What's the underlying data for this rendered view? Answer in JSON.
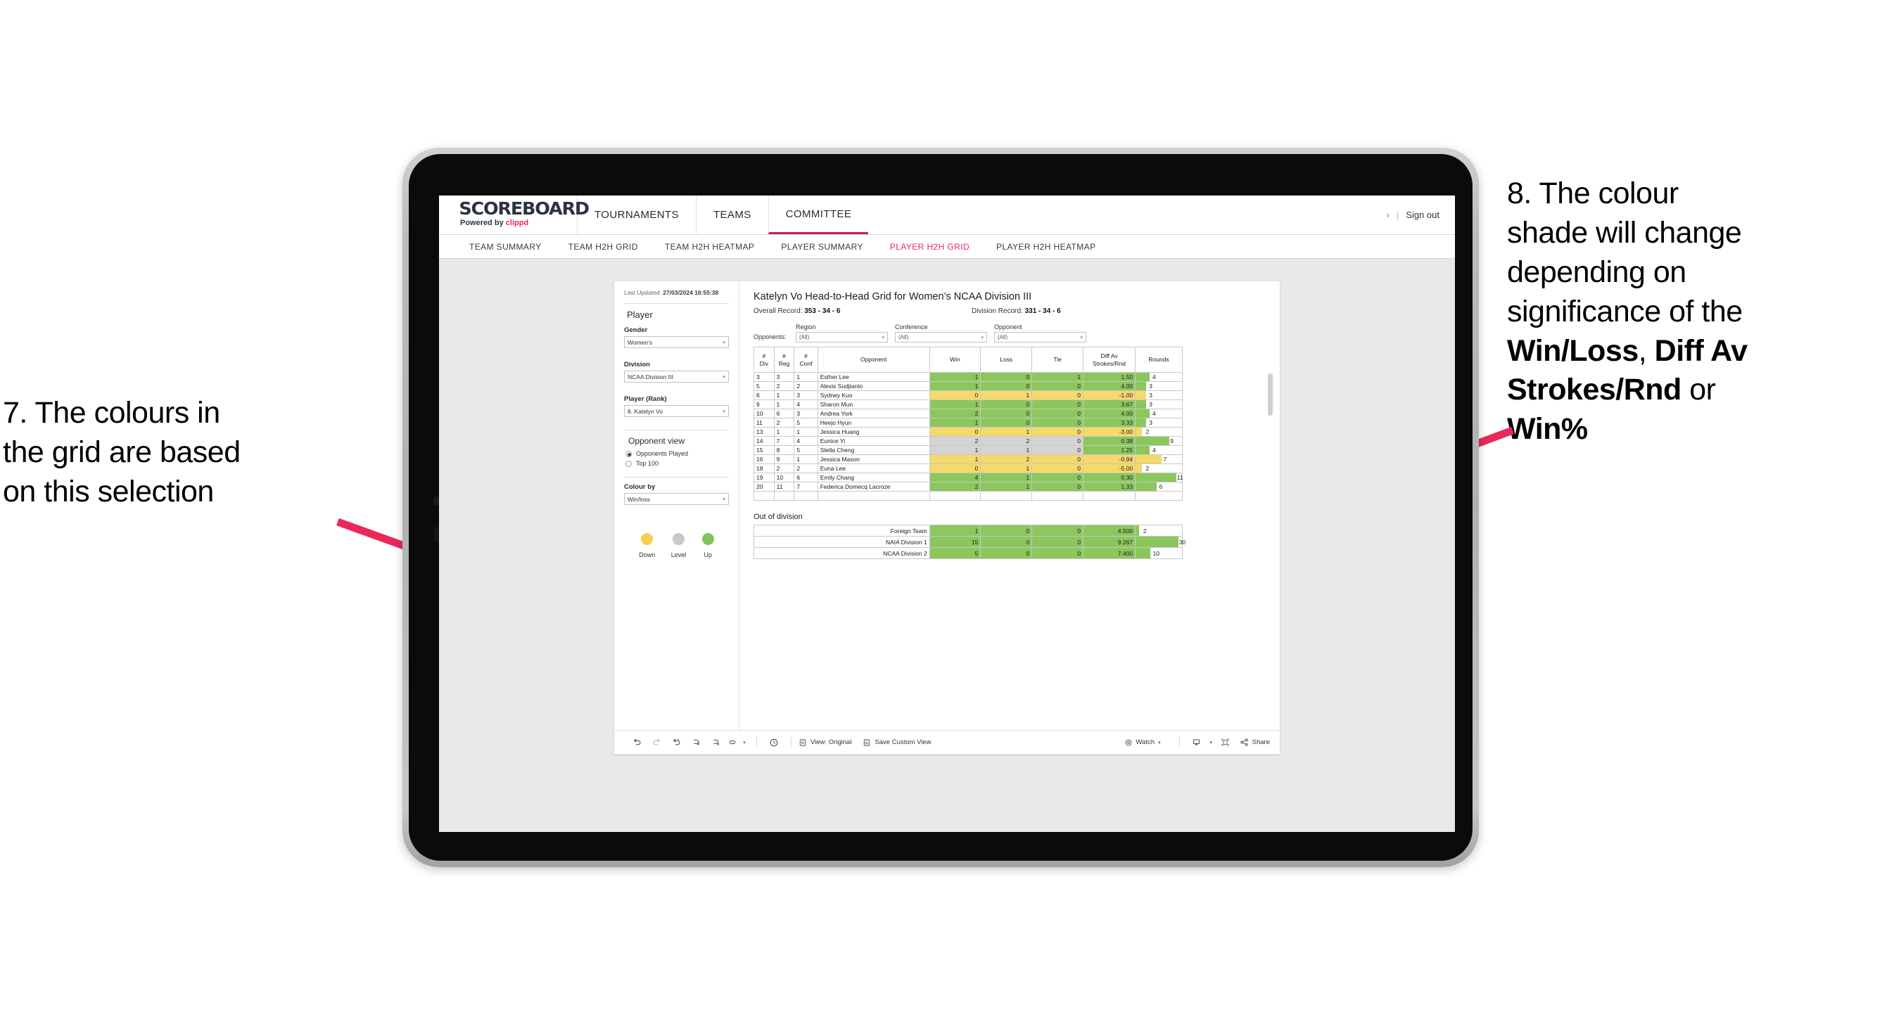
{
  "annotations": {
    "left": {
      "line1": "7. The colours in",
      "line2": "the grid are based",
      "line3": "on this selection"
    },
    "right": {
      "l1": "8. The colour",
      "l2": "shade will change",
      "l3": "depending on",
      "l4": "significance of the",
      "b1": "Win/Loss",
      "sep1": ", ",
      "b2": "Diff Av",
      "b3": "Strokes/Rnd",
      "mid": " or",
      "b4": "Win%"
    },
    "arrow_color": "#e8295a"
  },
  "header": {
    "logo_main": "SCOREBOARD",
    "logo_sub_prefix": "Powered by ",
    "logo_sub_brand": "clippd",
    "nav": [
      {
        "label": "TOURNAMENTS",
        "active": false
      },
      {
        "label": "TEAMS",
        "active": false
      },
      {
        "label": "COMMITTEE",
        "active": true
      }
    ],
    "chevron": "›",
    "divider": "|",
    "signout": "Sign out"
  },
  "subnav": [
    {
      "label": "TEAM SUMMARY",
      "active": false
    },
    {
      "label": "TEAM H2H GRID",
      "active": false
    },
    {
      "label": "TEAM H2H HEATMAP",
      "active": false
    },
    {
      "label": "PLAYER SUMMARY",
      "active": false
    },
    {
      "label": "PLAYER H2H GRID",
      "active": true
    },
    {
      "label": "PLAYER H2H HEATMAP",
      "active": false
    }
  ],
  "sidebar": {
    "last_updated_label": "Last Updated: ",
    "last_updated_value": "27/03/2024 16:55:38",
    "player_heading": "Player",
    "gender_label": "Gender",
    "gender_value": "Women’s",
    "division_label": "Division",
    "division_value": "NCAA Division III",
    "player_rank_label": "Player (Rank)",
    "player_rank_value": "8. Katelyn Vo",
    "opponent_view_heading": "Opponent view",
    "opponent_view_options": [
      {
        "label": "Opponents Played",
        "selected": true
      },
      {
        "label": "Top 100",
        "selected": false
      }
    ],
    "colour_by_label": "Colour by",
    "colour_by_value": "Win/loss",
    "legend": [
      {
        "label": "Down",
        "color": "#f3d14e"
      },
      {
        "label": "Level",
        "color": "#c6c8ca"
      },
      {
        "label": "Up",
        "color": "#82c35c"
      }
    ],
    "caret": "▾"
  },
  "main": {
    "title": "Katelyn Vo Head-to-Head Grid for Women’s NCAA Division III",
    "overall_record_label": "Overall Record: ",
    "overall_record_value": "353 -  34 - 6",
    "division_record_label": "Division Record: ",
    "division_record_value": "331 -  34 - 6",
    "opponents_label": "Opponents:",
    "filters": [
      {
        "label": "Region",
        "value": "(All)"
      },
      {
        "label": "Conference",
        "value": "(All)"
      },
      {
        "label": "Opponent",
        "value": "(All)"
      }
    ],
    "caret": "▾",
    "columns": [
      {
        "l1": "#",
        "l2": "Div"
      },
      {
        "l1": "#",
        "l2": "Reg"
      },
      {
        "l1": "#",
        "l2": "Conf"
      },
      {
        "l1": "Opponent",
        "l2": ""
      },
      {
        "l1": "Win",
        "l2": ""
      },
      {
        "l1": "Loss",
        "l2": ""
      },
      {
        "l1": "Tie",
        "l2": ""
      },
      {
        "l1": "Diff Av",
        "l2": "Strokes/Rnd"
      },
      {
        "l1": "Rounds",
        "l2": ""
      }
    ],
    "rows": [
      {
        "div": "3",
        "reg": "3",
        "conf": "1",
        "opponent": "Esther Lee",
        "win": "1",
        "loss": "0",
        "tie": "1",
        "diff": "1.50",
        "rounds": "4",
        "shade": "up",
        "bar_pct": 30
      },
      {
        "div": "5",
        "reg": "2",
        "conf": "2",
        "opponent": "Alexis Sudjianto",
        "win": "1",
        "loss": "0",
        "tie": "0",
        "diff": "4.00",
        "rounds": "3",
        "shade": "up",
        "bar_pct": 22
      },
      {
        "div": "6",
        "reg": "1",
        "conf": "3",
        "opponent": "Sydney Kuo",
        "win": "0",
        "loss": "1",
        "tie": "0",
        "diff": "-1.00",
        "rounds": "3",
        "shade": "down",
        "bar_pct": 22
      },
      {
        "div": "9",
        "reg": "1",
        "conf": "4",
        "opponent": "Sharon Mun",
        "win": "1",
        "loss": "0",
        "tie": "0",
        "diff": "3.67",
        "rounds": "3",
        "shade": "up",
        "bar_pct": 22
      },
      {
        "div": "10",
        "reg": "6",
        "conf": "3",
        "opponent": "Andrea York",
        "win": "2",
        "loss": "0",
        "tie": "0",
        "diff": "4.00",
        "rounds": "4",
        "shade": "up",
        "bar_pct": 30
      },
      {
        "div": "11",
        "reg": "2",
        "conf": "5",
        "opponent": "Heejo Hyun",
        "win": "1",
        "loss": "0",
        "tie": "0",
        "diff": "3.33",
        "rounds": "3",
        "shade": "up",
        "bar_pct": 22
      },
      {
        "div": "13",
        "reg": "1",
        "conf": "1",
        "opponent": "Jessica Huang",
        "win": "0",
        "loss": "1",
        "tie": "0",
        "diff": "-3.00",
        "rounds": "2",
        "shade": "down",
        "bar_pct": 14
      },
      {
        "div": "14",
        "reg": "7",
        "conf": "4",
        "opponent": "Eunice Yi",
        "win": "2",
        "loss": "2",
        "tie": "0",
        "diff": "0.38",
        "rounds": "9",
        "shade": "level",
        "bar_pct": 72,
        "diff_shade": "up"
      },
      {
        "div": "15",
        "reg": "8",
        "conf": "5",
        "opponent": "Stella Cheng",
        "win": "1",
        "loss": "1",
        "tie": "0",
        "diff": "1.25",
        "rounds": "4",
        "shade": "level",
        "bar_pct": 30,
        "diff_shade": "up"
      },
      {
        "div": "16",
        "reg": "9",
        "conf": "1",
        "opponent": "Jessica Mason",
        "win": "1",
        "loss": "2",
        "tie": "0",
        "diff": "-0.94",
        "rounds": "7",
        "shade": "down",
        "bar_pct": 56
      },
      {
        "div": "18",
        "reg": "2",
        "conf": "2",
        "opponent": "Euna Lee",
        "win": "0",
        "loss": "1",
        "tie": "0",
        "diff": "-5.00",
        "rounds": "2",
        "shade": "down",
        "bar_pct": 14
      },
      {
        "div": "19",
        "reg": "10",
        "conf": "6",
        "opponent": "Emily Chang",
        "win": "4",
        "loss": "1",
        "tie": "0",
        "diff": "0.30",
        "rounds": "11",
        "shade": "up",
        "bar_pct": 88
      },
      {
        "div": "20",
        "reg": "11",
        "conf": "7",
        "opponent": "Federica Domecq Lacroze",
        "win": "2",
        "loss": "1",
        "tie": "0",
        "diff": "1.33",
        "rounds": "6",
        "shade": "up",
        "bar_pct": 46
      }
    ],
    "out_of_division_title": "Out of division",
    "out_of_division_rows": [
      {
        "name": "Foreign Team",
        "win": "1",
        "loss": "0",
        "tie": "0",
        "diff": "4.500",
        "rounds": "2",
        "shade": "up",
        "bar_pct": 8
      },
      {
        "name": "NAIA Division 1",
        "win": "15",
        "loss": "0",
        "tie": "0",
        "diff": "9.267",
        "rounds": "30",
        "shade": "up",
        "bar_pct": 93
      },
      {
        "name": "NCAA Division 2",
        "win": "5",
        "loss": "0",
        "tie": "0",
        "diff": "7.400",
        "rounds": "10",
        "shade": "up",
        "bar_pct": 31
      }
    ]
  },
  "toolbar": {
    "icons": [
      "undo-icon",
      "redo-icon",
      "revert-icon",
      "refresh-icon",
      "pause-icon",
      "highlight-icon"
    ],
    "highlight_caret": "▾",
    "alerts_icon": "alerts-icon",
    "view_original": "View: Original",
    "save_custom_view": "Save Custom View",
    "watch": "Watch",
    "watch_caret": "▾",
    "download_caret": "▾",
    "share": "Share"
  },
  "colors": {
    "up": "#8cc75e",
    "down": "#f5d96a",
    "level": "#d4d4d4",
    "accent": "#e8295a"
  }
}
